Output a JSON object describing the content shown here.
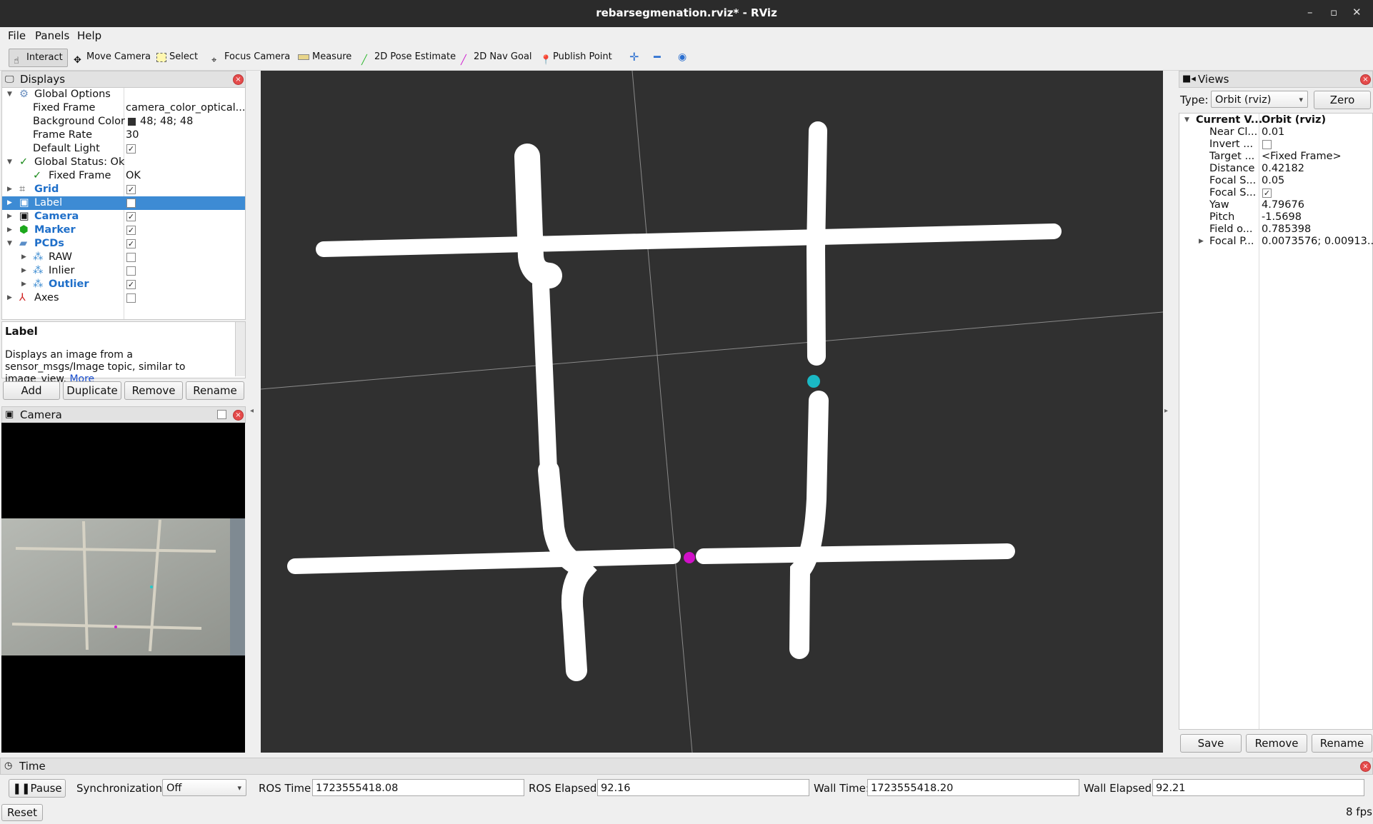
{
  "window": {
    "title": "rebarsegmenation.rviz* - RViz",
    "controls": [
      "–",
      "▫",
      "✕"
    ]
  },
  "menu": [
    "File",
    "Panels",
    "Help"
  ],
  "toolbar": {
    "interact": "Interact",
    "move_camera": "Move Camera",
    "select": "Select",
    "focus_camera": "Focus Camera",
    "measure": "Measure",
    "pose_estimate": "2D Pose Estimate",
    "nav_goal": "2D Nav Goal",
    "publish_point": "Publish Point"
  },
  "displays": {
    "title": "Displays",
    "global_options": "Global Options",
    "fixed_frame_label": "Fixed Frame",
    "fixed_frame_value": "camera_color_optical...",
    "bg_color_label": "Background Color",
    "bg_color_value": "48; 48; 48",
    "frame_rate_label": "Frame Rate",
    "frame_rate_value": "30",
    "default_light_label": "Default Light",
    "global_status": "Global Status: Ok",
    "status_fixed_frame": "Fixed Frame",
    "status_fixed_frame_value": "OK",
    "grid": "Grid",
    "label": "Label",
    "camera": "Camera",
    "marker": "Marker",
    "pcds": "PCDs",
    "raw": "RAW",
    "inlier": "Inlier",
    "outlier": "Outlier",
    "axes": "Axes",
    "desc_title": "Label",
    "desc_text": "Displays an image from a sensor_msgs/Image topic, similar to image_view.",
    "desc_more": "More",
    "add": "Add",
    "duplicate": "Duplicate",
    "remove": "Remove",
    "rename": "Rename"
  },
  "camera_panel": {
    "title": "Camera"
  },
  "views": {
    "title": "Views",
    "type_label": "Type:",
    "type_value": "Orbit (rviz)",
    "zero": "Zero",
    "rows": [
      {
        "name": "Current V...",
        "value": "Orbit (rviz)"
      },
      {
        "name": "Near Cl...",
        "value": "0.01"
      },
      {
        "name": "Invert ...",
        "value": ""
      },
      {
        "name": "Target ...",
        "value": "<Fixed Frame>"
      },
      {
        "name": "Distance",
        "value": "0.42182"
      },
      {
        "name": "Focal S...",
        "value": "0.05"
      },
      {
        "name": "Focal S...",
        "value": ""
      },
      {
        "name": "Yaw",
        "value": "4.79676"
      },
      {
        "name": "Pitch",
        "value": "-1.5698"
      },
      {
        "name": "Field o...",
        "value": "0.785398"
      },
      {
        "name": "Focal P...",
        "value": "0.0073576; 0.00913..."
      }
    ],
    "save": "Save",
    "remove": "Remove",
    "rename": "Rename"
  },
  "time": {
    "title": "Time",
    "pause": "Pause",
    "sync_label": "Synchronization:",
    "sync_value": "Off",
    "ros_time_label": "ROS Time:",
    "ros_time": "1723555418.08",
    "ros_elapsed_label": "ROS Elapsed:",
    "ros_elapsed": "92.16",
    "wall_time_label": "Wall Time:",
    "wall_time": "1723555418.20",
    "wall_elapsed_label": "Wall Elapsed:",
    "wall_elapsed": "92.21",
    "reset": "Reset",
    "fps": "8 fps"
  },
  "colors": {
    "viewport_bg": "#303030",
    "selection": "#3d8bd4",
    "cyan_marker": "#1ab8c4",
    "magenta_marker": "#d010c8"
  }
}
